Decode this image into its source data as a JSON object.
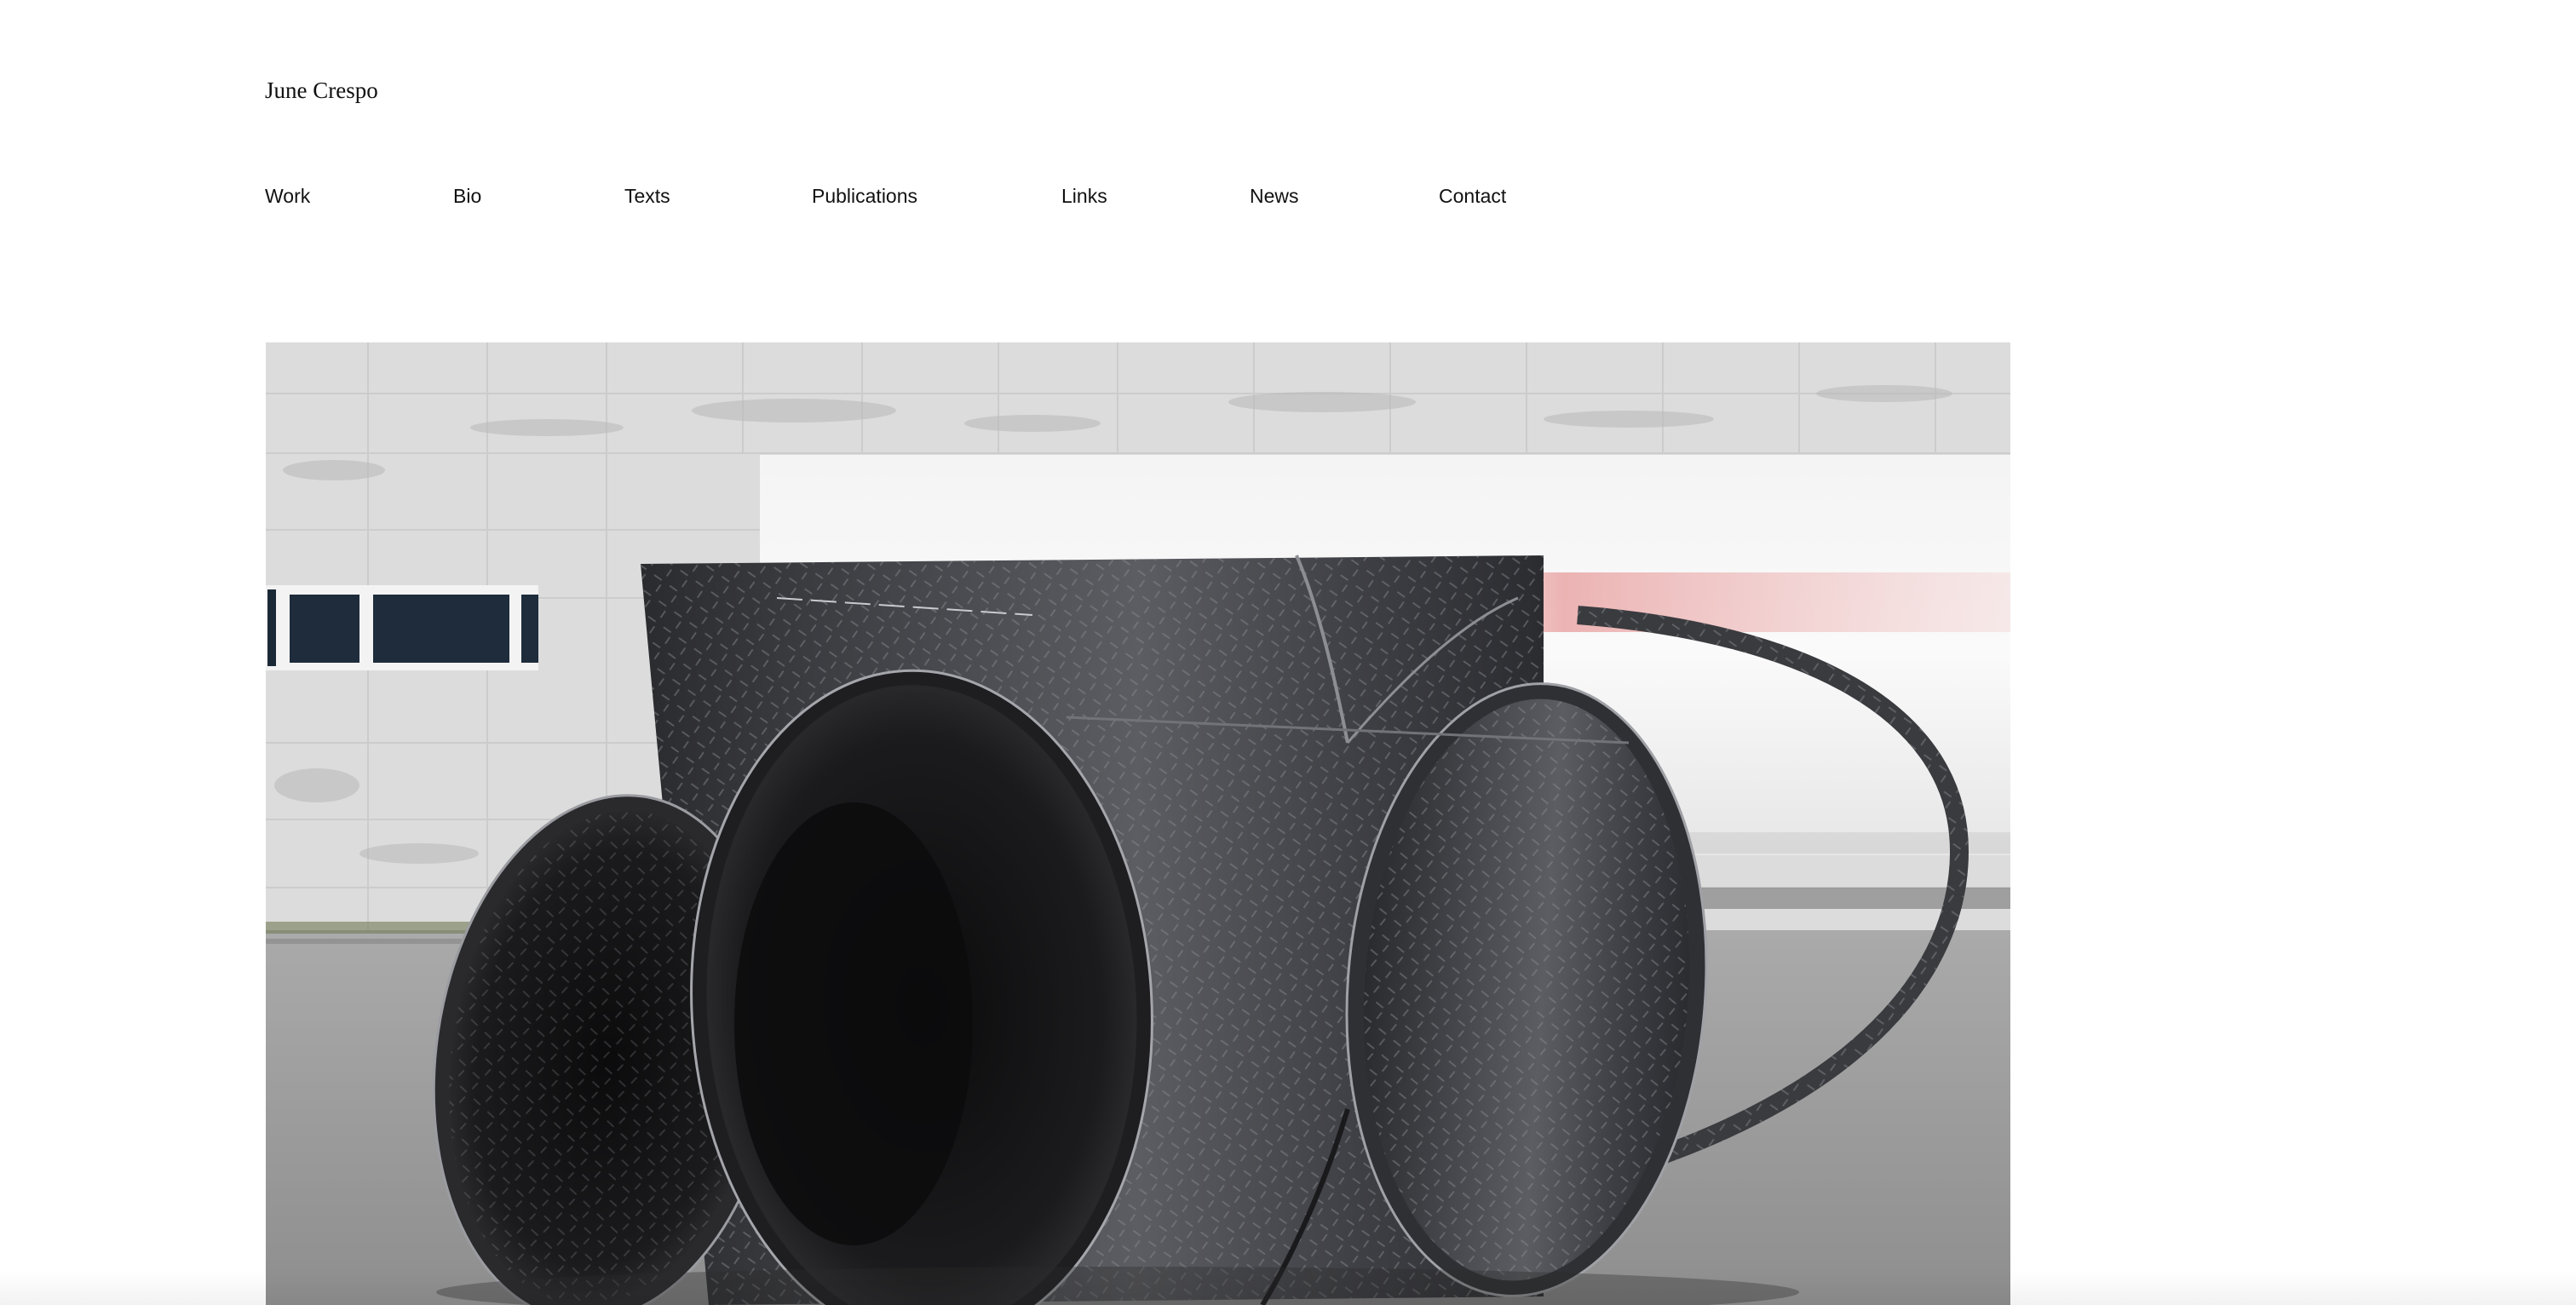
{
  "header": {
    "site_title": "June Crespo"
  },
  "nav": {
    "items": [
      {
        "label": "Work"
      },
      {
        "label": "Bio"
      },
      {
        "label": "Texts"
      },
      {
        "label": "Publications"
      },
      {
        "label": "Links"
      },
      {
        "label": "News"
      },
      {
        "label": "Contact"
      }
    ]
  },
  "hero": {
    "description": "Photograph of a large steel tread-plate sculpture of intersecting cylindrical loops on pavement in front of a marble wall",
    "colors": {
      "wall": "#dedede",
      "pavement": "#9a9a9a",
      "steel_dark": "#141414",
      "steel_mid": "#3c3d40",
      "steel_light": "#6c6d72"
    }
  }
}
